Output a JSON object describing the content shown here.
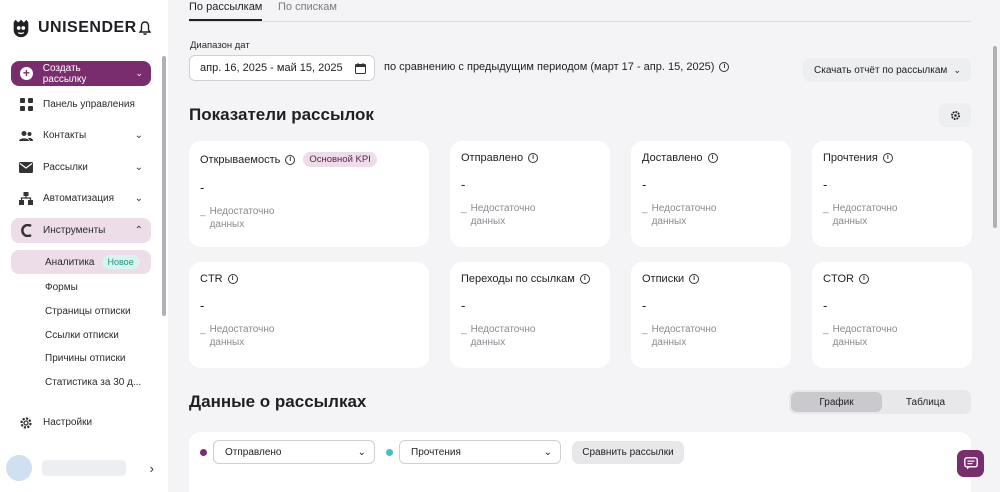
{
  "sidebar": {
    "brand": "UNISENDER",
    "create_label": "Создать рассылку",
    "items": [
      {
        "label": "Панель управления"
      },
      {
        "label": "Контакты"
      },
      {
        "label": "Рассылки"
      },
      {
        "label": "Автоматизация"
      },
      {
        "label": "Инструменты"
      }
    ],
    "sub_items": [
      {
        "label": "Аналитика",
        "badge": "Новое"
      },
      {
        "label": "Формы"
      },
      {
        "label": "Страницы отписки"
      },
      {
        "label": "Ссылки отписки"
      },
      {
        "label": "Причины отписки"
      },
      {
        "label": "Статистика за 30 д..."
      }
    ],
    "settings_label": "Настройки"
  },
  "tabs": [
    {
      "label": "По рассылкам",
      "active": true
    },
    {
      "label": "По спискам",
      "active": false
    }
  ],
  "filters": {
    "date_label": "Диапазон дат",
    "date_value": "апр. 16, 2025 - май 15, 2025",
    "compare_text": "по сравнению с предыдущим периодом (март 17 - апр. 15, 2025)",
    "download_label": "Скачать отчёт по рассылкам"
  },
  "metrics_title": "Показатели рассылок",
  "metrics": [
    {
      "title": "Открываемость",
      "badge": "Основной KPI",
      "value": "-",
      "note_dash": "_",
      "note1": "Недостаточно",
      "note2": "данных"
    },
    {
      "title": "Отправлено",
      "value": "-",
      "note_dash": "_",
      "note1": "Недостаточно",
      "note2": "данных"
    },
    {
      "title": "Доставлено",
      "value": "-",
      "note_dash": "_",
      "note1": "Недостаточно",
      "note2": "данных"
    },
    {
      "title": "Прочтения",
      "value": "-",
      "note_dash": "_",
      "note1": "Недостаточно",
      "note2": "данных"
    },
    {
      "title": "CTR",
      "value": "-",
      "note_dash": "_",
      "note1": "Недостаточно",
      "note2": "данных"
    },
    {
      "title": "Переходы по ссылкам",
      "value": "-",
      "note_dash": "_",
      "note1": "Недостаточно",
      "note2": "данных"
    },
    {
      "title": "Отписки",
      "value": "-",
      "note_dash": "_",
      "note1": "Недостаточно",
      "note2": "данных"
    },
    {
      "title": "CTOR",
      "value": "-",
      "note_dash": "_",
      "note1": "Недостаточно",
      "note2": "данных"
    }
  ],
  "data_section": {
    "title": "Данные о рассылках",
    "view_options": [
      "График",
      "Таблица"
    ],
    "select1": {
      "value": "Отправлено",
      "color": "#7a2d6e"
    },
    "select2": {
      "value": "Прочтения",
      "color": "#3fc1c9"
    },
    "compare_button": "Сравнить рассылки"
  },
  "colors": {
    "accent": "#7a2d6e",
    "active_bg": "#ecdde8",
    "badge_new_text": "#1b9a80"
  },
  "icons": [
    "unisender-logo-icon",
    "bell-icon",
    "plus-icon",
    "dashboard-icon",
    "contacts-icon",
    "mail-icon",
    "automation-icon",
    "tools-icon",
    "gear-icon",
    "calendar-icon",
    "info-icon",
    "chevron-down-icon",
    "chevron-right-icon",
    "chat-icon"
  ]
}
